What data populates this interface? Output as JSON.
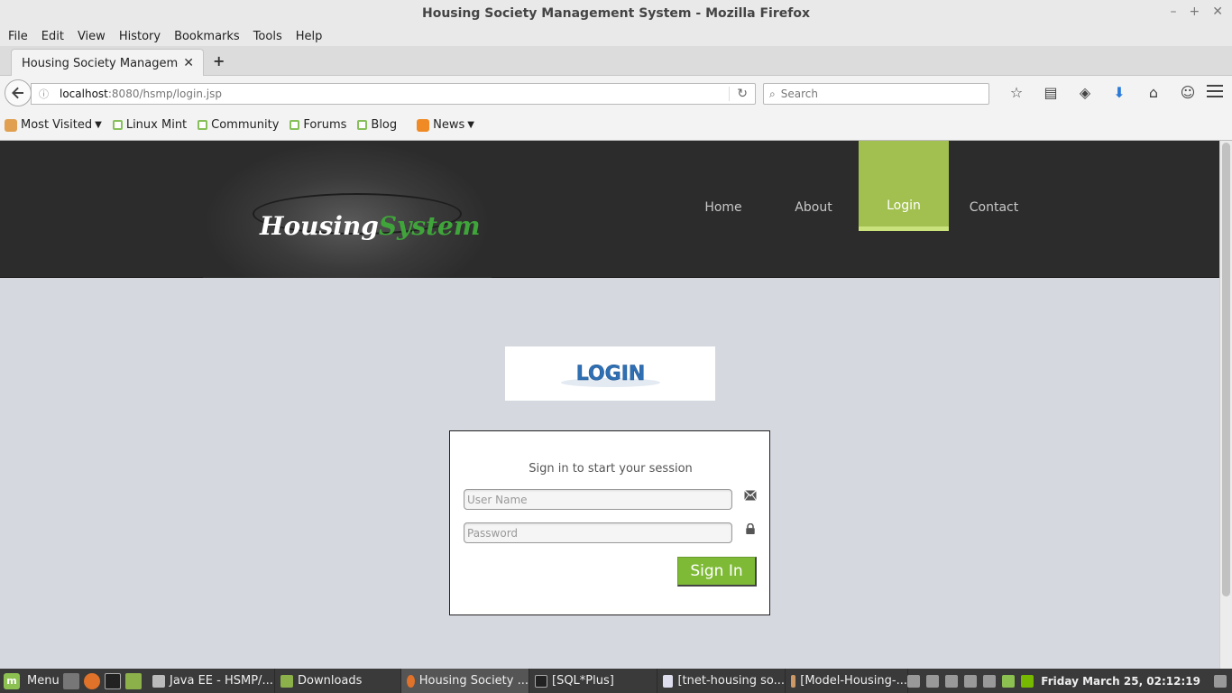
{
  "window": {
    "title": "Housing Society Management System - Mozilla Firefox"
  },
  "menubar": [
    "File",
    "Edit",
    "View",
    "History",
    "Bookmarks",
    "Tools",
    "Help"
  ],
  "tab": {
    "title": "Housing Society Managemen..."
  },
  "urlbar": {
    "host": "localhost",
    "path": ":8080/hsmp/login.jsp"
  },
  "searchbar": {
    "placeholder": "Search"
  },
  "bookmarks": [
    {
      "label": "Most Visited",
      "icon": "folder-icon",
      "dropdown": true
    },
    {
      "label": "Linux Mint",
      "icon": "mint-icon"
    },
    {
      "label": "Community",
      "icon": "mint-icon"
    },
    {
      "label": "Forums",
      "icon": "mint-icon"
    },
    {
      "label": "Blog",
      "icon": "mint-icon"
    },
    {
      "label": "News",
      "icon": "rss-icon",
      "dropdown": true
    }
  ],
  "site": {
    "logo_part1": "Housing",
    "logo_part2": "System",
    "nav": [
      "Home",
      "About",
      "Login",
      "Contact"
    ],
    "active_nav": "Login",
    "banner_text": "LOGIN",
    "login": {
      "message": "Sign in to start your session",
      "username_placeholder": "User Name",
      "password_placeholder": "Password",
      "submit_label": "Sign In"
    }
  },
  "taskbar": {
    "menu_label": "Menu",
    "windows": [
      {
        "label": "Java EE - HSMP/...",
        "active": false
      },
      {
        "label": "Downloads",
        "active": false
      },
      {
        "label": "Housing Society ...",
        "active": true
      },
      {
        "label": "[SQL*Plus]",
        "active": false
      },
      {
        "label": "[tnet-housing so...",
        "active": false
      },
      {
        "label": "[Model-Housing-...",
        "active": false
      }
    ],
    "clock": "Friday March 25, 02:12:19"
  },
  "colors": {
    "accent": "#a2c050",
    "logo_green": "#3fa53a",
    "signin": "#7fba37",
    "header_bg": "#2c2c2c",
    "page_bg": "#d5d8df"
  }
}
